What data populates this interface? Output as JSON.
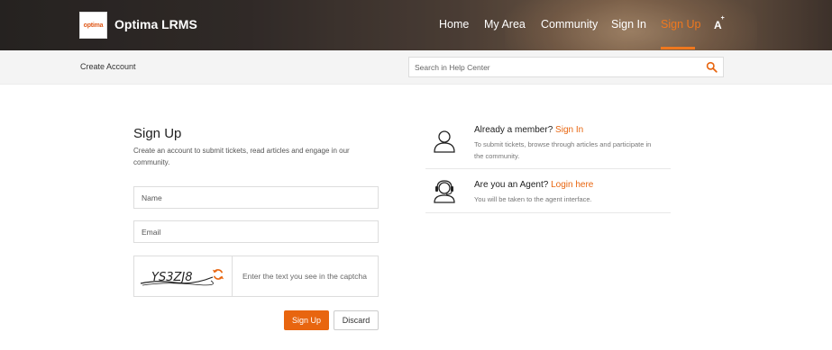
{
  "header": {
    "logo_text": "optima",
    "brand": "Optima LRMS",
    "nav": [
      {
        "label": "Home",
        "active": false
      },
      {
        "label": "My Area",
        "active": false
      },
      {
        "label": "Community",
        "active": false
      },
      {
        "label": "Sign In",
        "active": false
      },
      {
        "label": "Sign Up",
        "active": true
      }
    ],
    "font_size_icon": "font-size-icon",
    "accent_color": "#f0781e"
  },
  "subbar": {
    "breadcrumb": "Create Account",
    "search_placeholder": "Search in Help Center",
    "search_icon": "search-icon"
  },
  "form": {
    "title": "Sign Up",
    "subtitle": "Create an account to submit tickets, read articles and engage in our community.",
    "name_placeholder": "Name",
    "email_placeholder": "Email",
    "captcha_text": "YS3ZJ8",
    "captcha_placeholder": "Enter the text you see in the captcha",
    "signup_label": "Sign Up",
    "discard_label": "Discard"
  },
  "info": {
    "member_question": "Already a member?",
    "member_link": "Sign In",
    "member_desc": "To submit tickets, browse through articles and participate in the community.",
    "agent_question": "Are you an Agent?",
    "agent_link": "Login here",
    "agent_desc": "You will be taken to the agent interface."
  }
}
